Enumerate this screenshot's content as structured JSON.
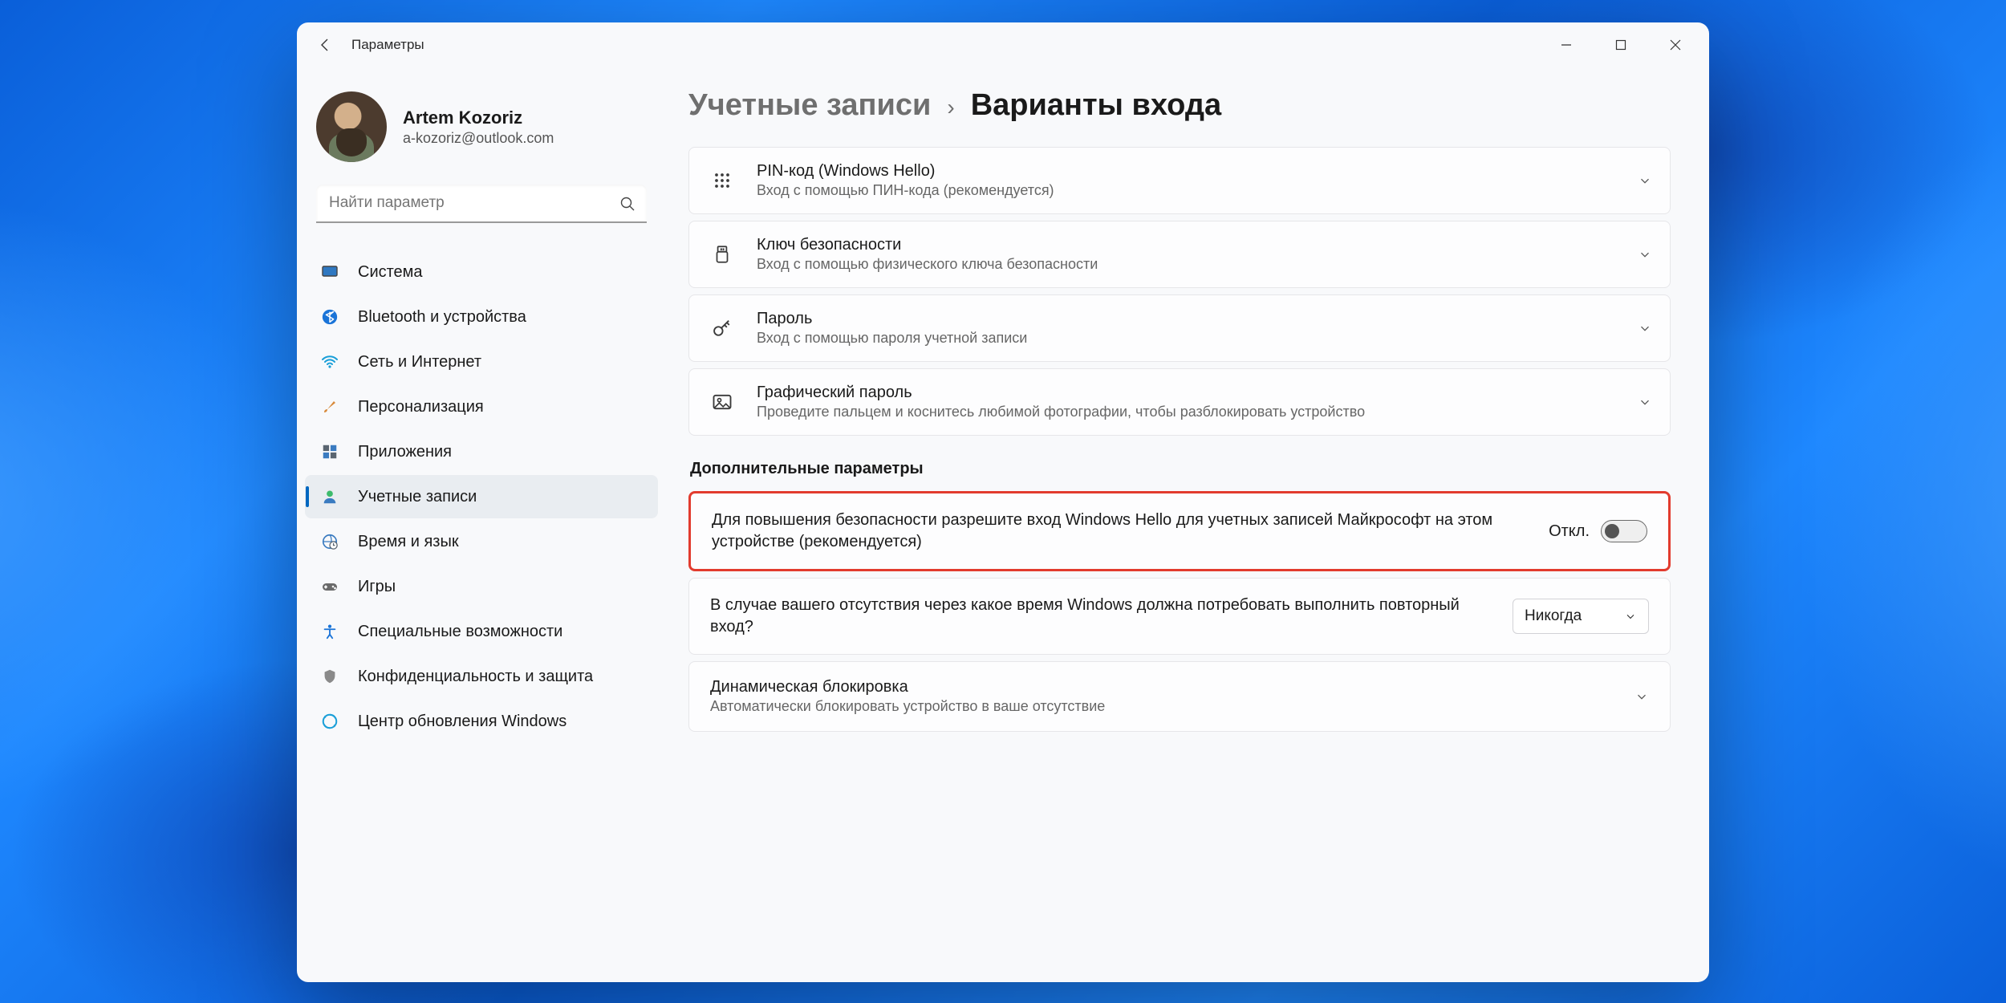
{
  "titlebar": {
    "app_name": "Параметры"
  },
  "user": {
    "name": "Artem Kozoriz",
    "email": "a-kozoriz@outlook.com"
  },
  "search": {
    "placeholder": "Найти параметр"
  },
  "sidebar": {
    "items": [
      {
        "label": "Система"
      },
      {
        "label": "Bluetooth и устройства"
      },
      {
        "label": "Сеть и Интернет"
      },
      {
        "label": "Персонализация"
      },
      {
        "label": "Приложения"
      },
      {
        "label": "Учетные записи"
      },
      {
        "label": "Время и язык"
      },
      {
        "label": "Игры"
      },
      {
        "label": "Специальные возможности"
      },
      {
        "label": "Конфиденциальность и защита"
      },
      {
        "label": "Центр обновления Windows"
      }
    ]
  },
  "breadcrumb": {
    "parent": "Учетные записи",
    "current": "Варианты входа"
  },
  "signin_options": [
    {
      "title": "PIN-код (Windows Hello)",
      "subtitle": "Вход с помощью ПИН-кода (рекомендуется)"
    },
    {
      "title": "Ключ безопасности",
      "subtitle": "Вход с помощью физического ключа безопасности"
    },
    {
      "title": "Пароль",
      "subtitle": "Вход с помощью пароля учетной записи"
    },
    {
      "title": "Графический пароль",
      "subtitle": "Проведите пальцем и коснитесь любимой фотографии, чтобы разблокировать устройство"
    }
  ],
  "additional": {
    "heading": "Дополнительные параметры",
    "hello_only": {
      "text": "Для повышения безопасности разрешите вход Windows Hello для учетных записей Майкрософт на этом устройстве (рекомендуется)",
      "state_label": "Откл.",
      "state": false
    },
    "require_signin": {
      "text": "В случае вашего отсутствия через какое время Windows должна потребовать выполнить повторный вход?",
      "selected": "Никогда"
    },
    "dynamic_lock": {
      "title": "Динамическая блокировка",
      "subtitle": "Автоматически блокировать устройство в ваше отсутствие"
    }
  }
}
